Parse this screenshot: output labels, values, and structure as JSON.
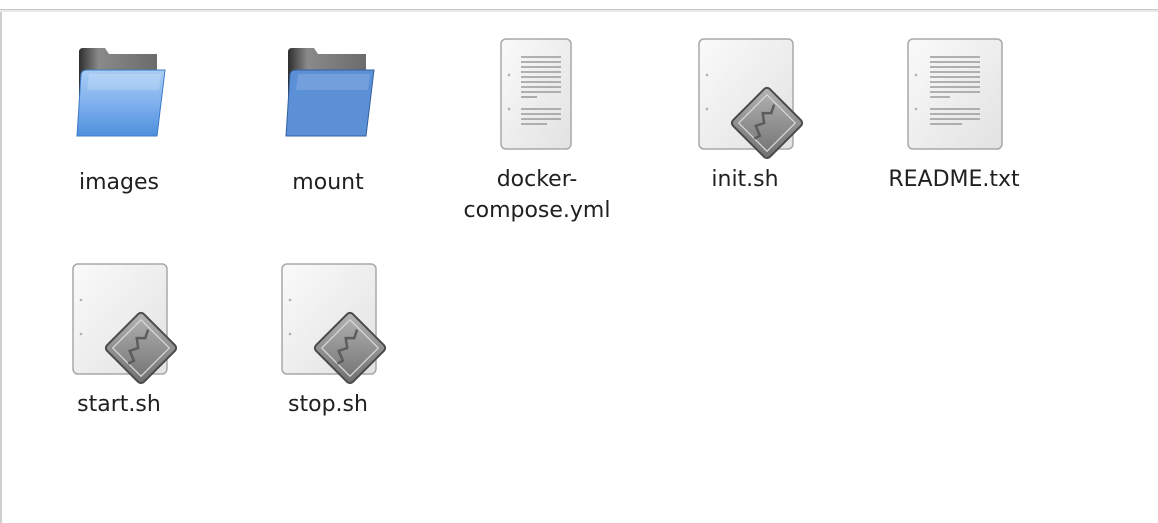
{
  "files": [
    {
      "name": "images",
      "icon": "folder-icon"
    },
    {
      "name": "mount",
      "icon": "folder-icon"
    },
    {
      "name": "docker-compose.yml",
      "icon": "text-file-icon"
    },
    {
      "name": "init.sh",
      "icon": "script-file-icon"
    },
    {
      "name": "README.txt",
      "icon": "text-file-icon"
    },
    {
      "name": "start.sh",
      "icon": "script-file-icon"
    },
    {
      "name": "stop.sh",
      "icon": "script-file-icon"
    }
  ],
  "colors": {
    "folder_front": "#5b9be4",
    "folder_back": "#4a4a4a",
    "page": "#f2f2f2",
    "diamond": "#8a8a8a"
  }
}
